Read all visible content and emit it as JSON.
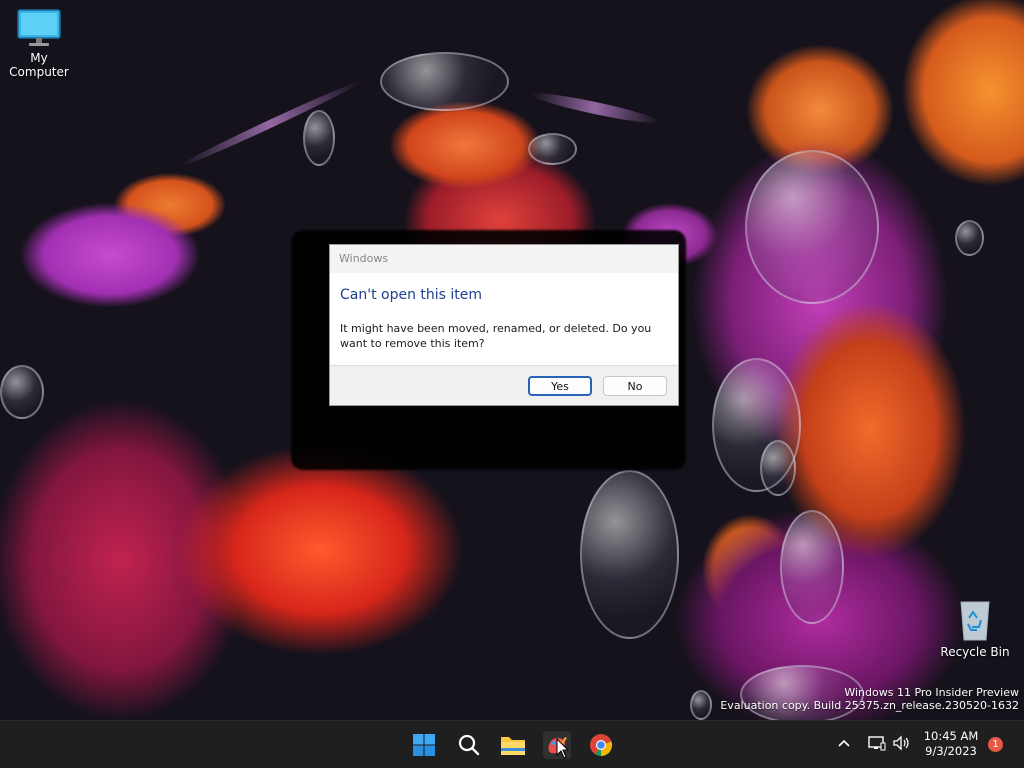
{
  "desktop": {
    "icons": [
      {
        "label": "My Computer",
        "icon": "monitor-icon"
      },
      {
        "label": "Recycle Bin",
        "icon": "recycle-bin-icon"
      }
    ],
    "watermark": {
      "line1": "Windows 11 Pro Insider Preview",
      "line2": "Evaluation copy. Build 25375.zn_release.230520-1632"
    }
  },
  "dialog": {
    "title": "Windows",
    "heading": "Can't open this item",
    "message": "It might have been moved, renamed, or deleted. Do you want to remove this item?",
    "buttons": {
      "yes": "Yes",
      "no": "No"
    },
    "accent_color": "#1f3f8f"
  },
  "taskbar": {
    "apps": [
      {
        "name": "start",
        "icon": "windows-start-icon"
      },
      {
        "name": "search",
        "icon": "search-icon"
      },
      {
        "name": "file-explorer",
        "icon": "folder-icon"
      },
      {
        "name": "paint",
        "icon": "paint-icon"
      },
      {
        "name": "chrome",
        "icon": "chrome-icon"
      }
    ],
    "tray": {
      "time": "10:45 AM",
      "date": "9/3/2023",
      "notification_count": "1"
    }
  }
}
